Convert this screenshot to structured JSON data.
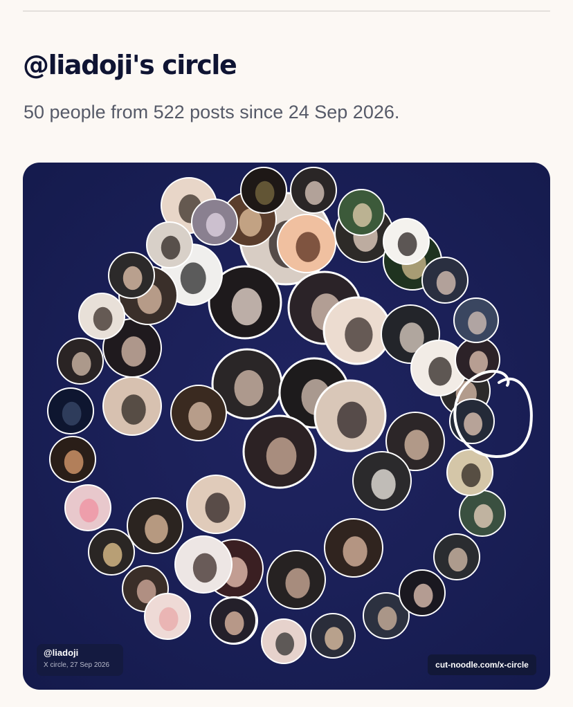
{
  "header": {
    "title": "@liadoji's circle",
    "subtitle": "50 people from 522 posts since 24 Sep 2026."
  },
  "card": {
    "background_color": "#1b2058",
    "avatar_ring_color": "#ffffff",
    "annotation_color": "#ffffff",
    "footer": {
      "handle": "@liadoji",
      "caption": "X circle, 27 Sep 2026",
      "link": "cut-noodle.com/x-circle"
    }
  }
}
